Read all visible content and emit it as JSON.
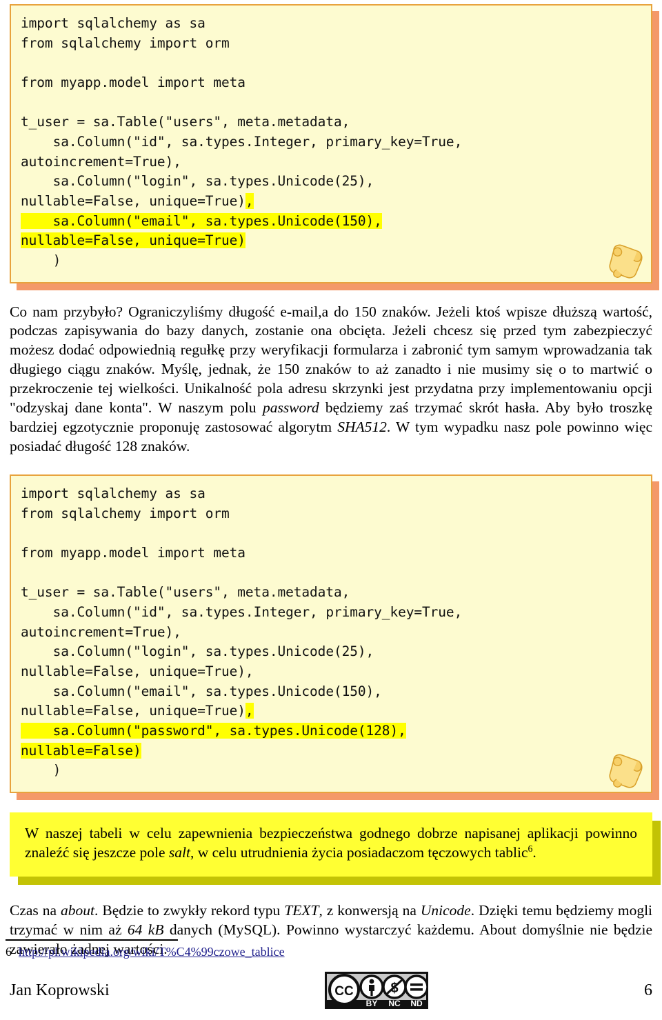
{
  "page": {
    "author": "Jan Koprowski",
    "page_number": "6"
  },
  "code_block_1": {
    "name": "sqlalchemy-user-table-with-email",
    "lines": [
      {
        "text": "import sqlalchemy as sa",
        "highlight": "none"
      },
      {
        "text": "from sqlalchemy import orm",
        "highlight": "none"
      },
      {
        "text": "",
        "highlight": "none"
      },
      {
        "text": "from myapp.model import meta",
        "highlight": "none"
      },
      {
        "text": "",
        "highlight": "none"
      },
      {
        "text": "t_user = sa.Table(\"users\", meta.metadata,",
        "highlight": "none"
      },
      {
        "text": "    sa.Column(\"id\", sa.types.Integer, primary_key=True,",
        "highlight": "none"
      },
      {
        "text": "autoincrement=True),",
        "highlight": "none"
      },
      {
        "text": "    sa.Column(\"login\", sa.types.Unicode(25),",
        "highlight": "none"
      },
      {
        "text": "nullable=False, unique=True),",
        "highlight": "trailing-comma"
      },
      {
        "text": "    sa.Column(\"email\", sa.types.Unicode(150),",
        "highlight": "full"
      },
      {
        "text": "nullable=False, unique=True)",
        "highlight": "full"
      },
      {
        "text": "    )",
        "highlight": "none"
      }
    ]
  },
  "paragraph_1": {
    "runs": [
      {
        "text": "Co nam przybyło? Ograniczyliśmy długość e-mail,a do 150 znaków. Jeżeli ktoś wpisze dłuższą wartość, podczas zapisywania do bazy danych, zostanie ona obcięta. Jeżeli chcesz się przed tym zabezpieczyć możesz dodać odpowiednią regułkę przy weryfikacji formularza i zabronić tym samym wprowadzania tak długiego ciągu znaków. Myślę, jednak, że 150 znaków to aż zanadto i nie musimy się o to martwić o przekroczenie tej wielkości. Unikalność pola adresu skrzynki jest przydatna przy implementowaniu opcji \"odzyskaj dane konta\". W naszym polu ",
        "style": "normal"
      },
      {
        "text": "password",
        "style": "italic"
      },
      {
        "text": " będziemy zaś trzymać skrót hasła. Aby było troszkę bardziej egzotycznie proponuję zastosować algorytm ",
        "style": "normal"
      },
      {
        "text": "SHA512",
        "style": "italic"
      },
      {
        "text": ". W tym wypadku nasz pole powinno więc posiadać długość 128 znaków.",
        "style": "normal"
      }
    ]
  },
  "code_block_2": {
    "name": "sqlalchemy-user-table-with-password",
    "lines": [
      {
        "text": "import sqlalchemy as sa",
        "highlight": "none"
      },
      {
        "text": "from sqlalchemy import orm",
        "highlight": "none"
      },
      {
        "text": "",
        "highlight": "none"
      },
      {
        "text": "from myapp.model import meta",
        "highlight": "none"
      },
      {
        "text": "",
        "highlight": "none"
      },
      {
        "text": "t_user = sa.Table(\"users\", meta.metadata,",
        "highlight": "none"
      },
      {
        "text": "    sa.Column(\"id\", sa.types.Integer, primary_key=True,",
        "highlight": "none"
      },
      {
        "text": "autoincrement=True),",
        "highlight": "none"
      },
      {
        "text": "    sa.Column(\"login\", sa.types.Unicode(25),",
        "highlight": "none"
      },
      {
        "text": "nullable=False, unique=True),",
        "highlight": "none"
      },
      {
        "text": "    sa.Column(\"email\", sa.types.Unicode(150),",
        "highlight": "none"
      },
      {
        "text": "nullable=False, unique=True),",
        "highlight": "trailing-comma"
      },
      {
        "text": "    sa.Column(\"password\", sa.types.Unicode(128),",
        "highlight": "full"
      },
      {
        "text": "nullable=False)",
        "highlight": "full"
      },
      {
        "text": "    )",
        "highlight": "none"
      }
    ]
  },
  "callout": {
    "runs": [
      {
        "text": "W naszej tabeli w celu zapewnienia bezpieczeństwa godnego dobrze napisanej aplikacji powinno znaleźć się jeszcze pole ",
        "style": "normal"
      },
      {
        "text": "salt",
        "style": "italic"
      },
      {
        "text": ", w celu utrudnienia życia posiadaczom tęczowych tablic",
        "style": "normal"
      },
      {
        "text": "6",
        "style": "superscript"
      },
      {
        "text": ".",
        "style": "normal"
      }
    ]
  },
  "paragraph_2": {
    "runs": [
      {
        "text": "Czas na ",
        "style": "normal"
      },
      {
        "text": "about",
        "style": "italic"
      },
      {
        "text": ". Będzie to zwykły rekord typu ",
        "style": "normal"
      },
      {
        "text": "TEXT",
        "style": "italic"
      },
      {
        "text": ", z konwersją na ",
        "style": "normal"
      },
      {
        "text": "Unicode",
        "style": "italic"
      },
      {
        "text": ". Dzięki temu będziemy mogli trzymać w nim aż ",
        "style": "normal"
      },
      {
        "text": "64 kB",
        "style": "italic"
      },
      {
        "text": " danych (MySQL). Powinno wystarczyć każdemu. About domyślnie nie będzie zawierało żadnej wartości.",
        "style": "normal"
      }
    ]
  },
  "footnote": {
    "marker": "6",
    "url": "http://pl.wikipedia.org/wiki/T%C4%99czowe_tablice"
  },
  "license_badge": {
    "name": "creative-commons-by-nc-nd-badge",
    "cc_text": "CC",
    "terms": [
      "BY",
      "NC",
      "ND"
    ]
  },
  "colors": {
    "code_bg": "#fdfbd0",
    "code_border": "#e8a33d",
    "code_shadow": "#f2874f",
    "highlight": "#ffff00",
    "callout_bg": "#ffff33",
    "callout_shadow": "#c3c305",
    "link": "#20208c"
  }
}
